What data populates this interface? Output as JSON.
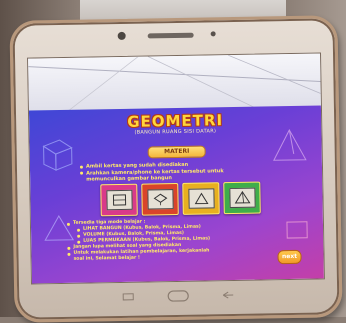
{
  "app": {
    "title": "GEOMETRI",
    "subtitle": "(BANGUN RUANG SISI DATAR)",
    "menu_label": "MATERI",
    "next_label": "next"
  },
  "instructions": [
    "Ambil kertas yang sudah disediakan",
    "Arahkan kamera/phone ke kertas tersebut untuk",
    "memunculkan gambar bangun"
  ],
  "notes": {
    "intro": "Tersedia tiga mode belajar :",
    "modes": [
      "LIHAT BANGUN (Kubus, Balok, Prisma, Limas)",
      "VOLUME (Kubus, Balok, Prisma, Limas)",
      "LUAS PERMUKAAN (Kubus, Balok, Prisma, Limas)"
    ],
    "extra_1": "Jangan lupa melihat soal yang disediakan",
    "extra_2": "Untuk melakukan latihan pembelajaran, kerjakanlah",
    "extra_3": "soal ini, Selamat belajar !"
  },
  "cards": [
    {
      "color": "#d93a8a"
    },
    {
      "color": "#d9442a"
    },
    {
      "color": "#e8b020"
    },
    {
      "color": "#3fae4a"
    }
  ]
}
